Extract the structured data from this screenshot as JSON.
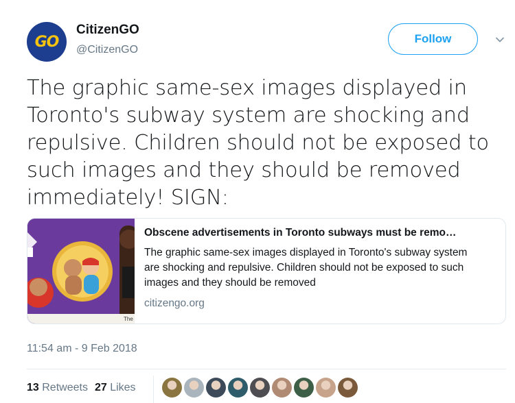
{
  "author": {
    "logo_text": "GO",
    "display_name": "CitizenGO",
    "screen_name": "@CitizenGO"
  },
  "follow_label": "Follow",
  "tweet_text": "The graphic same-sex images displayed in Toronto's subway system are shocking and repulsive. Children should not be exposed to such images and they should be removed immediately! SIGN:",
  "card": {
    "title": "Obscene advertisements in Toronto subways must be remo…",
    "description": "The graphic same-sex images displayed in Toronto's subway system are shocking and repulsive. Children should not be exposed to such images and they should be removed",
    "domain": "citizengo.org",
    "image_caption": "The"
  },
  "timestamp": "11:54 am - 9 Feb 2018",
  "stats": {
    "retweets_count": "13",
    "retweets_label": "Retweets",
    "likes_count": "27",
    "likes_label": "Likes"
  },
  "likers": [
    {
      "color": "#8a7440"
    },
    {
      "color": "#a9b4bd"
    },
    {
      "color": "#3c4a5a"
    },
    {
      "color": "#2f5c6b"
    },
    {
      "color": "#4d4d52"
    },
    {
      "color": "#b08a73"
    },
    {
      "color": "#3d5e47"
    },
    {
      "color": "#c7a38c"
    },
    {
      "color": "#7a5a3a"
    }
  ],
  "colors": {
    "accent": "#1da1f2",
    "secondary_text": "#657786",
    "card_image_bg": "#6a3b9c"
  },
  "icons": [
    "caret-down-icon"
  ]
}
